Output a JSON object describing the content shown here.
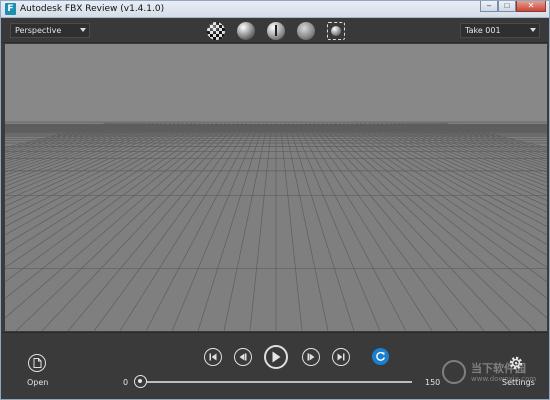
{
  "window": {
    "title": "Autodesk FBX Review (v1.4.1.0)",
    "app_icon_glyph": "F",
    "minimize_glyph": "–",
    "maximize_glyph": "□",
    "close_glyph": "✕"
  },
  "toolbar": {
    "camera_select": "Perspective",
    "take_select": "Take 001",
    "shading_buttons": [
      "checker-sphere-icon",
      "solid-sphere-icon",
      "light-sphere-icon",
      "matte-sphere-icon",
      "frame-selection-icon"
    ]
  },
  "controls": {
    "open_label": "Open",
    "settings_label": "Settings",
    "time_start": "0",
    "time_end": "150",
    "current_frame_fraction": 0.0
  },
  "watermark": {
    "text": "当下软件园",
    "url": "www.downxia.com"
  },
  "colors": {
    "viewport_bg": "#878787",
    "grid_line": "#5e5e5e",
    "panel_bg": "#3a3a3a",
    "loop_accent": "#1b7fd1"
  }
}
